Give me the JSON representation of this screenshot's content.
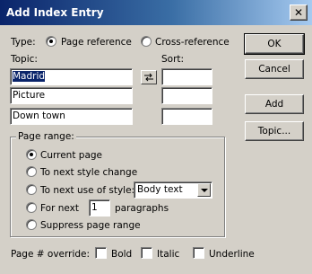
{
  "window": {
    "title": "Add Index Entry",
    "close_glyph": "✕"
  },
  "type": {
    "label": "Type:",
    "page_reference": "Page reference",
    "cross_reference": "Cross-reference",
    "selected": "Page reference"
  },
  "topic": {
    "label": "Topic:",
    "fields": [
      "Madrid",
      "Picture",
      "Down town"
    ]
  },
  "sort": {
    "label": "Sort:",
    "fields": [
      "",
      "",
      ""
    ]
  },
  "swap_icon": "swap-icon",
  "page_range": {
    "title": "Page range:",
    "options": [
      "Current page",
      "To next style change",
      "To next use of style:",
      "For next",
      "Suppress page range"
    ],
    "selected": "Current page",
    "style_value": "Body text",
    "for_next_value": "1",
    "paragraphs_label": "paragraphs"
  },
  "override": {
    "label": "Page # override:",
    "bold": "Bold",
    "italic": "Italic",
    "underline": "Underline"
  },
  "buttons": {
    "ok": "OK",
    "cancel": "Cancel",
    "add": "Add",
    "topic": "Topic..."
  }
}
